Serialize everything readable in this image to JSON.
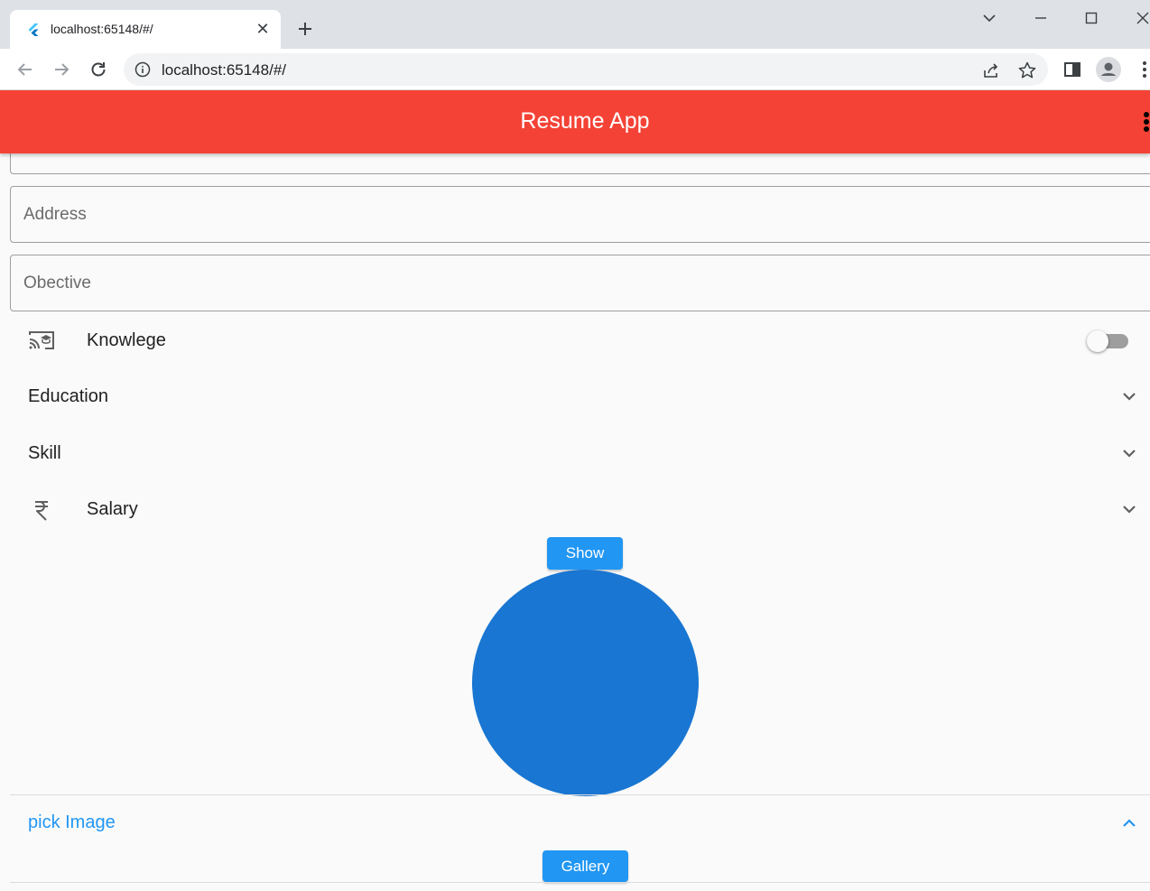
{
  "browser": {
    "tab_title": "localhost:65148/#/",
    "url": "localhost:65148/#/"
  },
  "app": {
    "title": "Resume App"
  },
  "form": {
    "address_placeholder": "Address",
    "objective_placeholder": "Obective"
  },
  "tiles": {
    "knowledge_label": "Knowlege",
    "knowledge_enabled": false,
    "education_label": "Education",
    "skill_label": "Skill",
    "salary_label": "Salary"
  },
  "buttons": {
    "show_label": "Show",
    "gallery_label": "Gallery"
  },
  "pick_image": {
    "label": "pick Image"
  },
  "colors": {
    "appbar": "#f44336",
    "accent": "#2196f3",
    "avatar": "#1976d2"
  }
}
